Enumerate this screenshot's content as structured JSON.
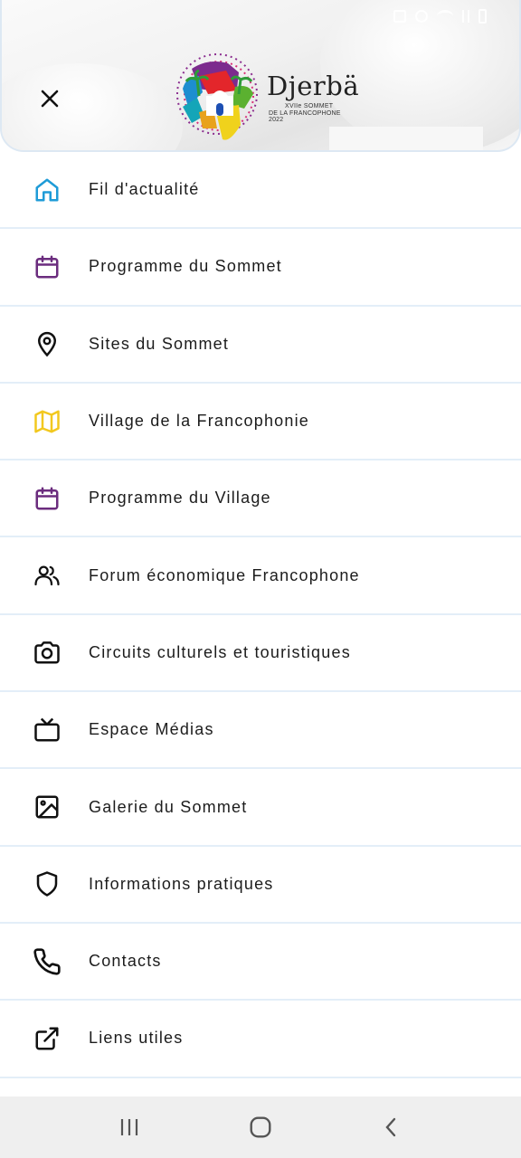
{
  "header": {
    "logo": {
      "wordmark": "Djerbä",
      "line1": "XVIIe SOMMET",
      "line2": "DE LA FRANCOPHONE 2022"
    },
    "close_icon": "close-icon"
  },
  "menu": {
    "items": [
      {
        "label": "Fil d'actualité",
        "icon": "home-icon",
        "color": "#1e9bd7"
      },
      {
        "label": "Programme du Sommet",
        "icon": "calendar-icon",
        "color": "#6b2c7e"
      },
      {
        "label": "Sites du Sommet",
        "icon": "map-pin-icon",
        "color": "#111111"
      },
      {
        "label": "Village de la Francophonie",
        "icon": "map-icon",
        "color": "#f2c81e"
      },
      {
        "label": "Programme du Village",
        "icon": "calendar-icon",
        "color": "#6b2c7e"
      },
      {
        "label": "Forum économique Francophone",
        "icon": "users-icon",
        "color": "#111111"
      },
      {
        "label": "Circuits culturels et touristiques",
        "icon": "camera-icon",
        "color": "#111111"
      },
      {
        "label": "Espace Médias",
        "icon": "tv-icon",
        "color": "#111111"
      },
      {
        "label": "Galerie du Sommet",
        "icon": "image-icon",
        "color": "#111111"
      },
      {
        "label": "Informations pratiques",
        "icon": "shield-icon",
        "color": "#111111"
      },
      {
        "label": "Contacts",
        "icon": "phone-icon",
        "color": "#111111"
      },
      {
        "label": "Liens utiles",
        "icon": "external-link-icon",
        "color": "#111111"
      }
    ]
  },
  "navbar": {
    "recents": "recents-icon",
    "home": "home-circle-icon",
    "back": "back-icon"
  }
}
